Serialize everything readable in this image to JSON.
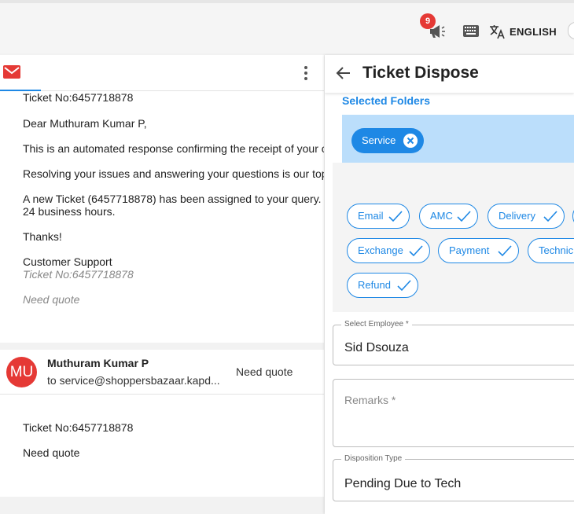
{
  "header": {
    "notification_count": "9",
    "language_label": "ENGLISH"
  },
  "mail_list": {
    "first": {
      "lines": [
        "Ticket No:6457718878",
        "Dear Muthuram Kumar P,",
        "This is an automated response confirming the receipt of your c",
        "Resolving your issues and answering your questions is our top",
        "A new Ticket (6457718878) has been assigned to your query. .",
        "24 business hours.",
        "Thanks!",
        "Customer Support"
      ],
      "quoted_ticket": "Ticket No:6457718878",
      "quoted_subject": "Need quote"
    },
    "second": {
      "avatar_initials": "MU",
      "sender": "Muthuram Kumar P",
      "to": "to service@shoppersbazaar.kapd...",
      "subject": "Need quote",
      "body_lines": [
        "Ticket No:6457718878",
        "Need quote"
      ]
    }
  },
  "dispose": {
    "title": "Ticket Dispose",
    "selected_folders_label": "Selected Folders",
    "selected_chips": [
      "Service"
    ],
    "folder_chips": [
      "Email",
      "AMC",
      "Delivery",
      "Exchange",
      "Payment",
      "Technic",
      "Refund"
    ],
    "employee": {
      "label": "Select Employee *",
      "value": "Sid Dsouza"
    },
    "remarks": {
      "placeholder": "Remarks *"
    },
    "disposition": {
      "label": "Disposition Type",
      "value": "Pending Due to Tech"
    }
  },
  "icons": [
    "megaphone-icon",
    "keyboard-icon",
    "translate-icon",
    "mail-icon",
    "more-vertical-icon",
    "arrow-left-icon",
    "close-circle-icon",
    "check-icon"
  ],
  "colors": {
    "accent": "#1e88e5",
    "badge": "#e53935",
    "folder_area": "#bbdefb"
  }
}
